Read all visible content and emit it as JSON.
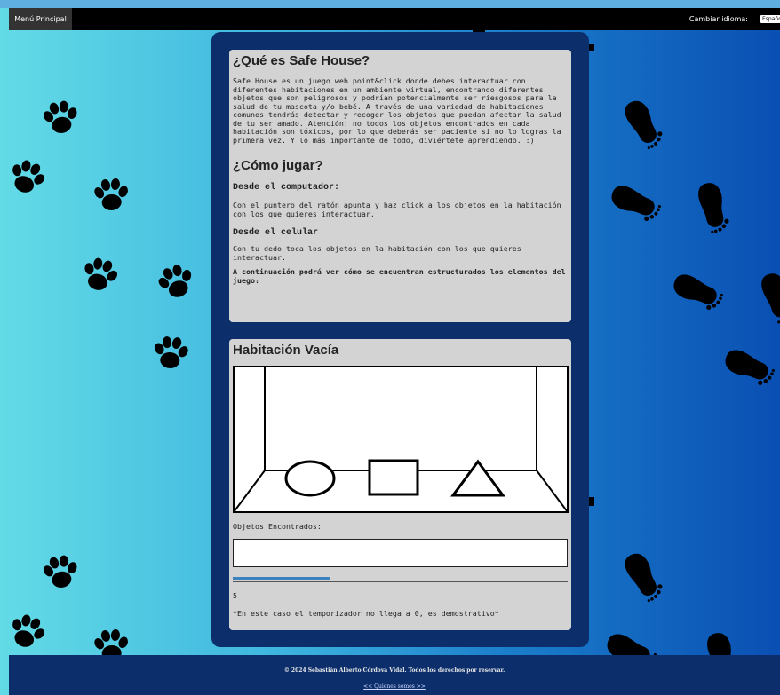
{
  "nav": {
    "menu_label": "Menú Principal",
    "language_label": "Cambiar idioma:",
    "language_value": "Español"
  },
  "about": {
    "title": "¿Qué es Safe House?",
    "description": "Safe House es un juego web point&click donde debes interactuar con diferentes habitaciones en un ambiente virtual, encontrando diferentes objetos que son peligrosos y podrían potencialmente ser riesgosos para la salud de tu mascota y/o bebé. A través de una variedad de habitaciones comunes tendrás detectar y recoger los objetos que puedan afectar la salud de tu ser amado. Atención: no todos los objetos encontrados en cada habitación son tóxicos, por lo que deberás ser paciente si no lo logras la primera vez. Y lo más importante de todo, diviértete aprendiendo. :)"
  },
  "howto": {
    "title": "¿Cómo jugar?",
    "desktop_heading": "Desde el computador:",
    "desktop_text": "Con el puntero del ratón apunta y haz click a los objetos en la habitación con los que quieres interactuar.",
    "mobile_heading": "Desde el celular",
    "mobile_text": "Con tu dedo toca los objetos en la habitación con los que quieres interactuar.",
    "structure_note": "A continuación podrá ver cómo se encuentran estructurados los elementos del juego:"
  },
  "room": {
    "title": "Habitación Vacía",
    "found_label": "Objetos Encontrados:",
    "timer_value": "5",
    "timer_progress": 0.29,
    "timer_note": "*En este caso el temporizador no llega a 0, es demostrativo*",
    "timer_color": "#3a83be"
  },
  "footer": {
    "copyright": "© 2024 Sebastián Alberto Córdova Vidal. Todos los derechos por reservar.",
    "about_link": "<< Quienes somos >>"
  },
  "colors": {
    "panel": "#0c2f6c",
    "card": "#d3d3d3",
    "navbar": "#000000"
  },
  "icons": [
    "paw-print-icon",
    "baby-footprint-icon"
  ]
}
